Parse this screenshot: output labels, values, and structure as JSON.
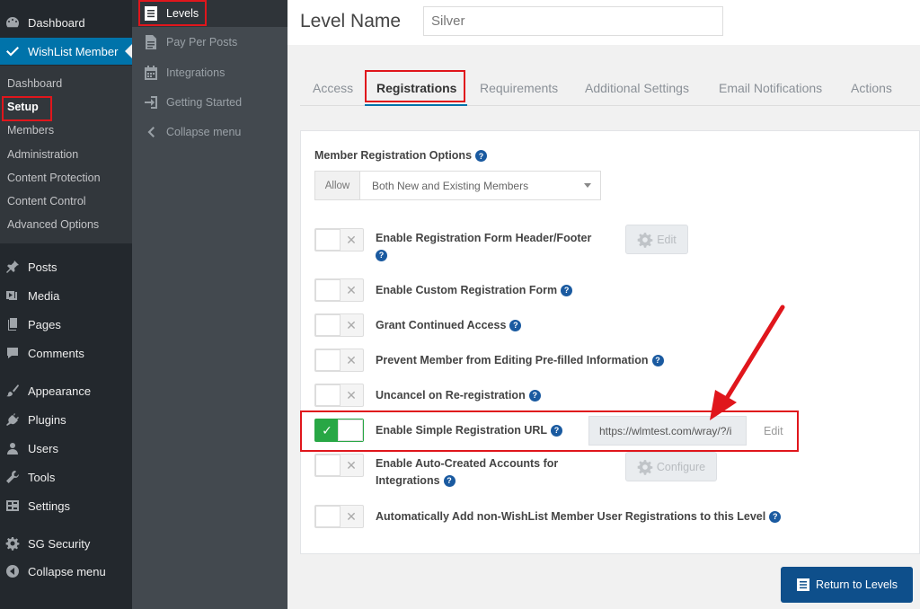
{
  "wp_menu": {
    "top_items": [
      {
        "label": "Dashboard",
        "icon": "gauge-icon"
      },
      {
        "label": "WishList Member",
        "icon": "check-icon"
      }
    ],
    "submenu": [
      "Dashboard",
      "Setup",
      "Members",
      "Administration",
      "Content Protection",
      "Content Control",
      "Advanced Options"
    ],
    "items": [
      {
        "label": "Posts",
        "icon": "pin-icon"
      },
      {
        "label": "Media",
        "icon": "media-icon"
      },
      {
        "label": "Pages",
        "icon": "pages-icon"
      },
      {
        "label": "Comments",
        "icon": "comment-icon"
      },
      {
        "label": "Appearance",
        "icon": "brush-icon"
      },
      {
        "label": "Plugins",
        "icon": "plug-icon"
      },
      {
        "label": "Users",
        "icon": "user-icon"
      },
      {
        "label": "Tools",
        "icon": "wrench-icon"
      },
      {
        "label": "Settings",
        "icon": "settings-icon"
      },
      {
        "label": "SG Security",
        "icon": "gear-icon"
      },
      {
        "label": "Collapse menu",
        "icon": "collapse-icon"
      }
    ]
  },
  "wlm_menu": {
    "items": [
      "Levels",
      "Pay Per Posts",
      "Integrations",
      "Getting Started",
      "Collapse menu"
    ]
  },
  "header": {
    "label": "Level Name",
    "value": "Silver"
  },
  "tabs": [
    "Access",
    "Registrations",
    "Requirements",
    "Additional Settings",
    "Email Notifications",
    "Actions"
  ],
  "registration": {
    "options_label": "Member Registration Options",
    "allow_addon": "Allow",
    "allow_value": "Both New and Existing Members",
    "options": [
      {
        "line1": "Enable Registration Form Header/Footer",
        "enabled": false
      },
      {
        "label": "Enable Custom Registration Form",
        "enabled": false
      },
      {
        "label": "Grant Continued Access",
        "enabled": false
      },
      {
        "label": "Prevent Member from Editing Pre-filled Information",
        "enabled": false
      },
      {
        "label": "Uncancel on Re-registration",
        "enabled": false
      },
      {
        "label": "Enable Simple Registration URL",
        "enabled": true
      },
      {
        "line1": "Enable Auto-Created Accounts for",
        "line2": "Integrations",
        "enabled": false
      },
      {
        "label": "Automatically Add non-WishList Member User Registrations to this Level",
        "enabled": false
      }
    ],
    "edit_label": "Edit",
    "configure_label": "Configure",
    "simple_url": "https://wlmtest.com/wray/?/i",
    "url_edit_label": "Edit"
  },
  "return_button": "Return to Levels",
  "colors": {
    "accent": "#0073aa",
    "highlight": "#e0161c",
    "toggle_on": "#28a745"
  }
}
